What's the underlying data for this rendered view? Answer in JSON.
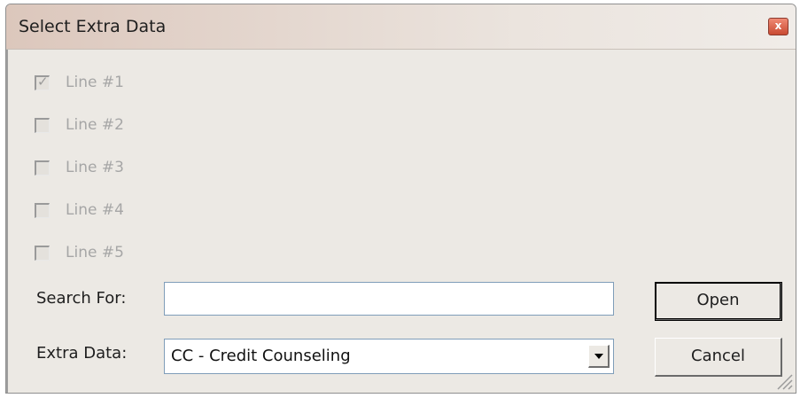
{
  "window": {
    "title": "Select Extra Data",
    "close_glyph": "x"
  },
  "checkboxes": [
    {
      "label": "Line #1",
      "checked": true,
      "enabled": false
    },
    {
      "label": "Line #2",
      "checked": false,
      "enabled": false
    },
    {
      "label": "Line #3",
      "checked": false,
      "enabled": false
    },
    {
      "label": "Line #4",
      "checked": false,
      "enabled": false
    },
    {
      "label": "Line #5",
      "checked": false,
      "enabled": false
    }
  ],
  "search": {
    "label": "Search For:",
    "value": "",
    "placeholder": ""
  },
  "extra_data": {
    "label": "Extra Data:",
    "selected": "CC - Credit Counseling"
  },
  "buttons": {
    "open": "Open",
    "cancel": "Cancel"
  },
  "icons": {
    "close": "close-icon",
    "check": "checkmark-icon",
    "dropdown": "chevron-down-icon",
    "resize": "resize-grip-icon"
  },
  "colors": {
    "disabled_text": "#a6a6a6",
    "dialog_background": "#ece9e4",
    "close_button": "#d85a40"
  }
}
